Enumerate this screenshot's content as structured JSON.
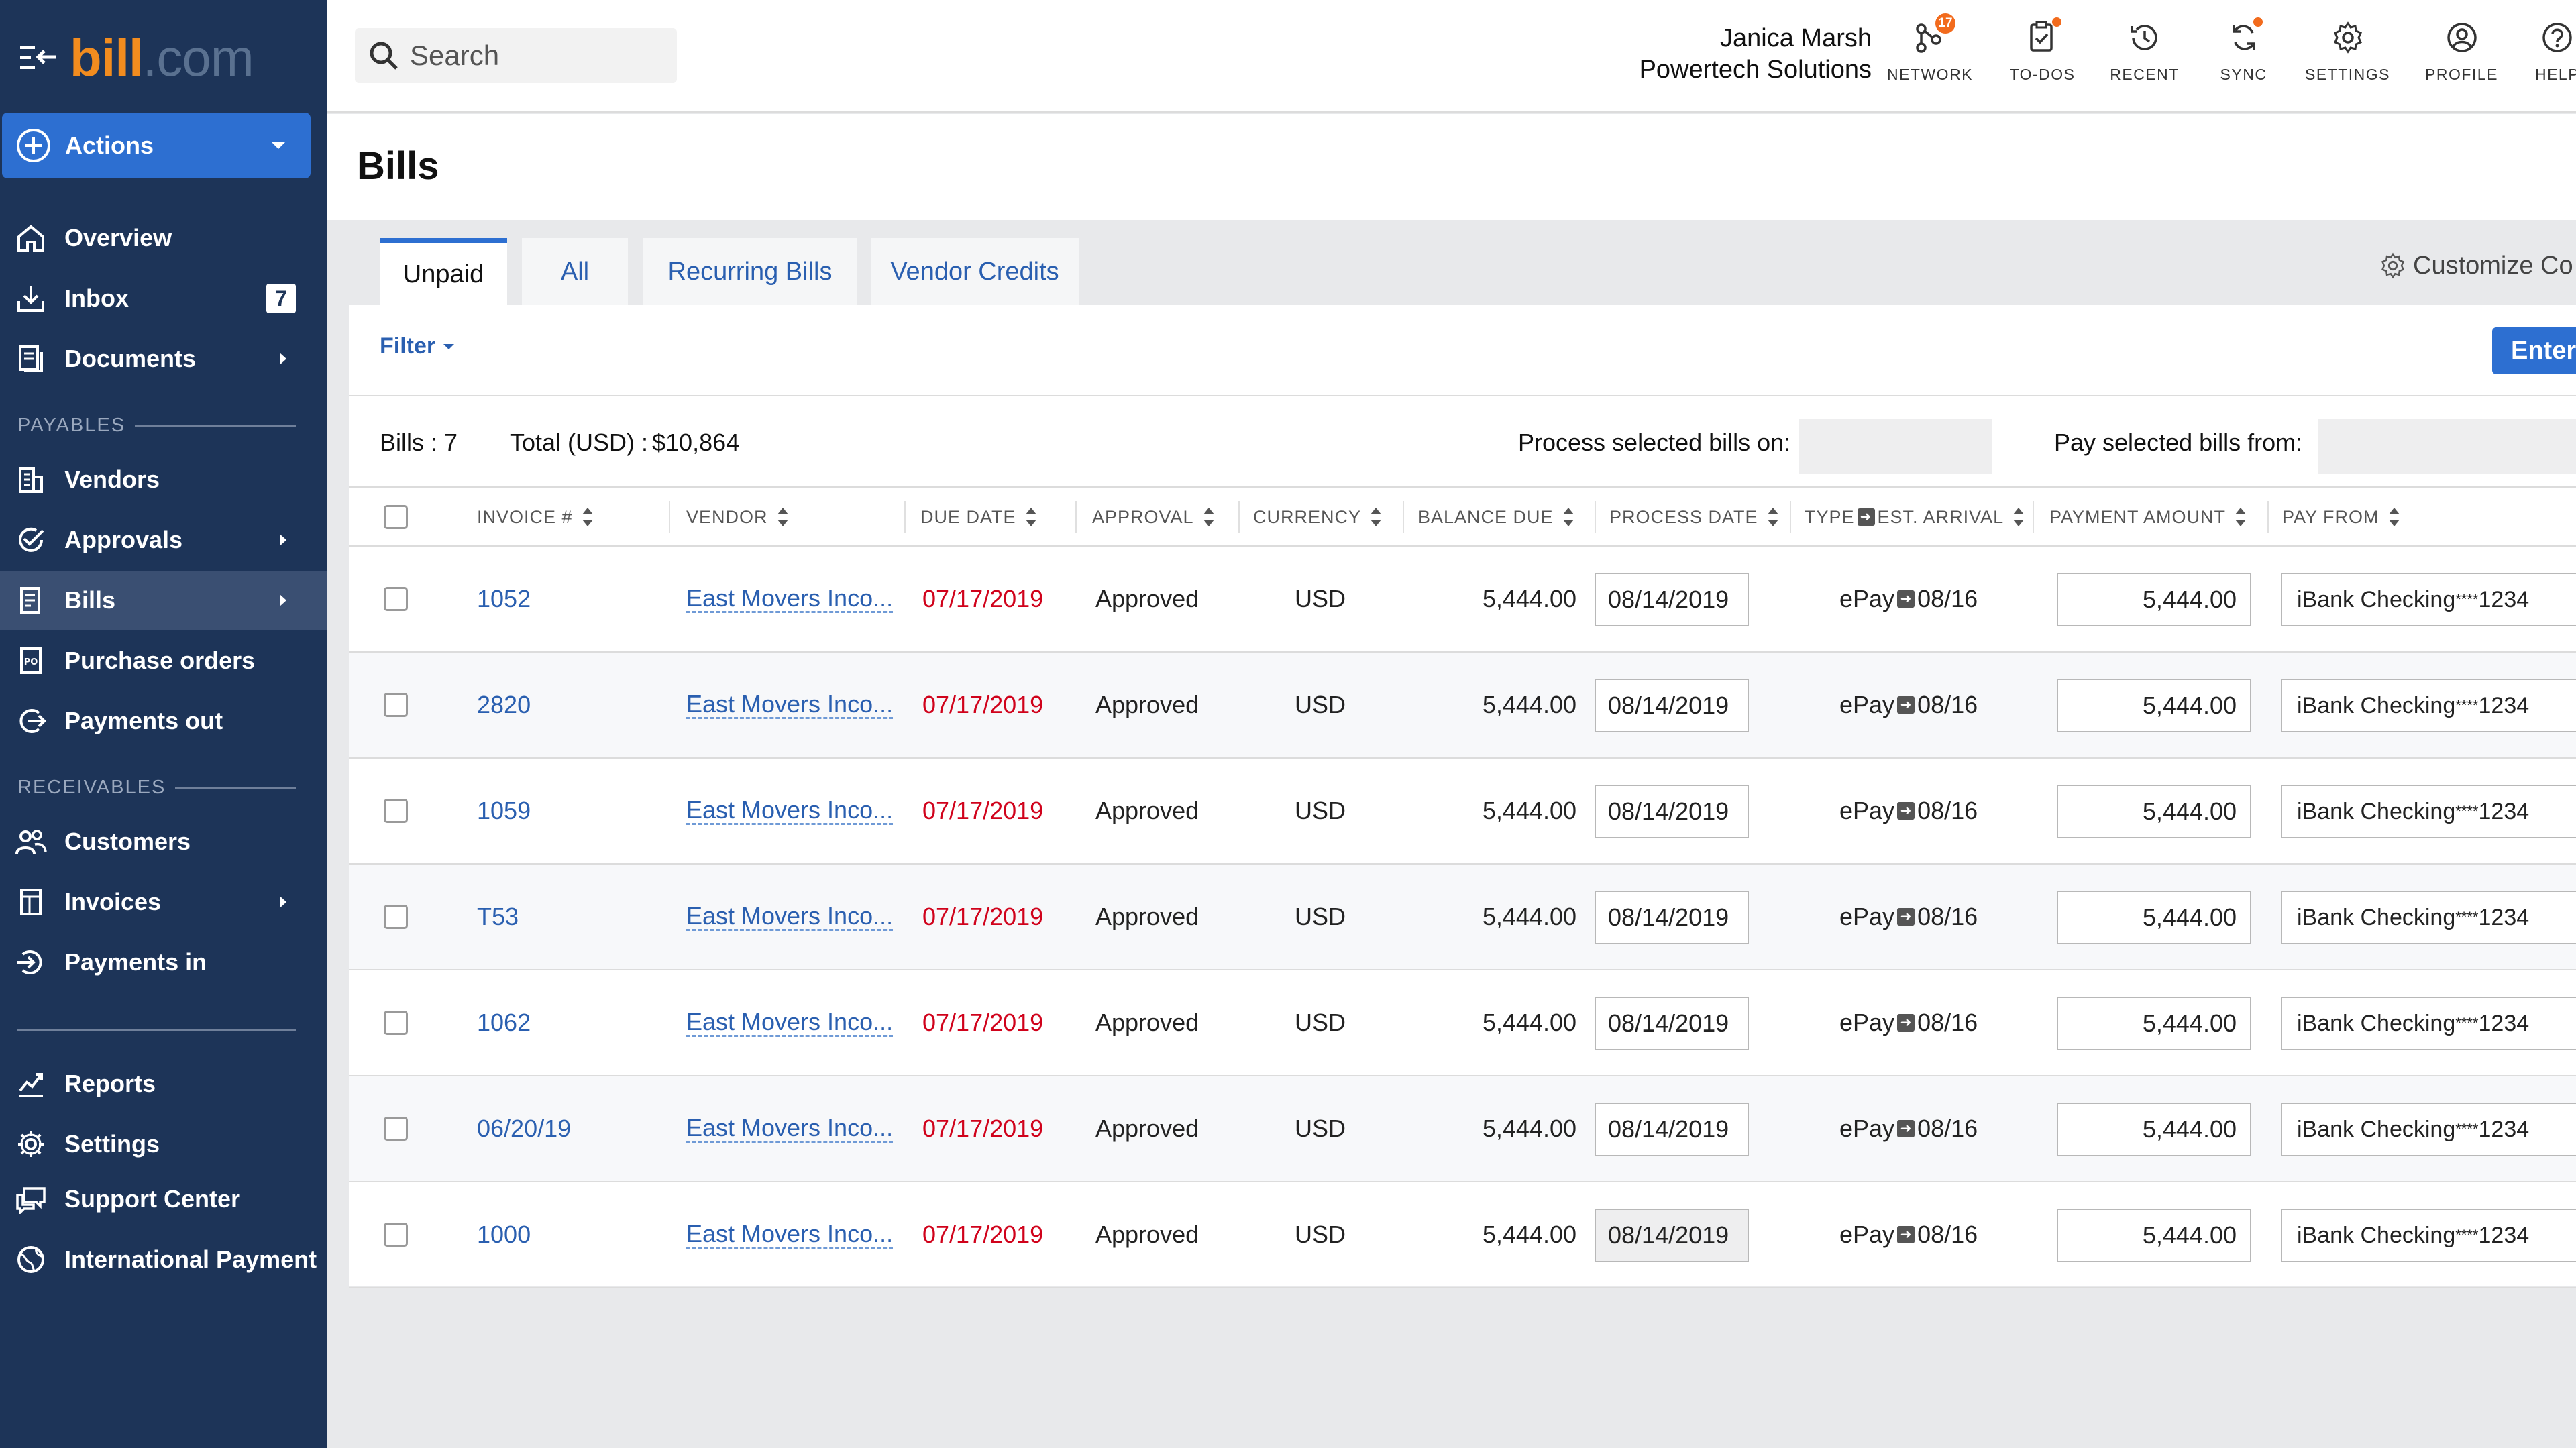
{
  "brand": {
    "bill": "bill",
    "com": ".com"
  },
  "actions_label": "Actions",
  "sidebar": {
    "items": [
      {
        "key": "overview",
        "label": "Overview"
      },
      {
        "key": "inbox",
        "label": "Inbox",
        "badge": "7"
      },
      {
        "key": "documents",
        "label": "Documents"
      },
      {
        "key": "vendors",
        "label": "Vendors"
      },
      {
        "key": "approvals",
        "label": "Approvals"
      },
      {
        "key": "bills",
        "label": "Bills"
      },
      {
        "key": "purchase-orders",
        "label": "Purchase orders"
      },
      {
        "key": "payments-out",
        "label": "Payments out"
      },
      {
        "key": "customers",
        "label": "Customers"
      },
      {
        "key": "invoices",
        "label": "Invoices"
      },
      {
        "key": "payments-in",
        "label": "Payments in"
      },
      {
        "key": "reports",
        "label": "Reports"
      },
      {
        "key": "settings",
        "label": "Settings"
      },
      {
        "key": "support-center",
        "label": "Support Center"
      },
      {
        "key": "international-payment",
        "label": "International Payment"
      }
    ],
    "sections": {
      "payables": "PAYABLES",
      "receivables": "RECEIVABLES"
    }
  },
  "header": {
    "search_placeholder": "Search",
    "user_name": "Janica Marsh",
    "company": "Powertech Solutions",
    "network_badge": "17",
    "icons": [
      {
        "key": "network",
        "label": "NETWORK",
        "icon": "network-icon"
      },
      {
        "key": "todos",
        "label": "TO-DOS",
        "icon": "clipboard-check-icon"
      },
      {
        "key": "recent",
        "label": "RECENT",
        "icon": "history-icon"
      },
      {
        "key": "sync",
        "label": "SYNC",
        "icon": "sync-icon"
      },
      {
        "key": "settings",
        "label": "SETTINGS",
        "icon": "gear-icon"
      },
      {
        "key": "profile",
        "label": "PROFILE",
        "icon": "user-icon"
      },
      {
        "key": "help",
        "label": "HELP",
        "icon": "help-icon"
      }
    ]
  },
  "page": {
    "title": "Bills"
  },
  "tabs": [
    "Unpaid",
    "All",
    "Recurring Bills",
    "Vendor Credits"
  ],
  "customize_label": "Customize Co",
  "filter_label": "Filter",
  "enter_label": "Enter",
  "summary": {
    "bills_label": "Bills :",
    "bills_count": "7",
    "total_label": "Total (USD) :",
    "total_value": "$10,864",
    "process_label": "Process selected bills on:",
    "pay_label": "Pay selected bills from:"
  },
  "table": {
    "columns": {
      "invoice": "INVOICE #",
      "vendor": "VENDOR",
      "due_date": "DUE DATE",
      "approval": "APPROVAL",
      "currency": "CURRENCY",
      "balance_due": "BALANCE DUE",
      "process_date": "PROCESS DATE",
      "type": "TYPE",
      "est_arrival": "EST. ARRIVAL",
      "payment_amount": "PAYMENT AMOUNT",
      "pay_from": "PAY FROM"
    },
    "rows": [
      {
        "invoice": "1052",
        "vendor": "East Movers Inco...",
        "due_date": "07/17/2019",
        "approval": "Approved",
        "currency": "USD",
        "balance_due": "5,444.00",
        "process_date": "08/14/2019",
        "type": "ePay",
        "est_arrival": "08/16",
        "payment_amount": "5,444.00",
        "pay_from_name": "iBank Checking ",
        "pay_from_mask": "****",
        "pay_from_last4": "1234"
      },
      {
        "invoice": "2820",
        "vendor": "East Movers Inco...",
        "due_date": "07/17/2019",
        "approval": "Approved",
        "currency": "USD",
        "balance_due": "5,444.00",
        "process_date": "08/14/2019",
        "type": "ePay",
        "est_arrival": "08/16",
        "payment_amount": "5,444.00",
        "pay_from_name": "iBank Checking ",
        "pay_from_mask": "****",
        "pay_from_last4": "1234"
      },
      {
        "invoice": "1059",
        "vendor": "East Movers Inco...",
        "due_date": "07/17/2019",
        "approval": "Approved",
        "currency": "USD",
        "balance_due": "5,444.00",
        "process_date": "08/14/2019",
        "type": "ePay",
        "est_arrival": "08/16",
        "payment_amount": "5,444.00",
        "pay_from_name": "iBank Checking ",
        "pay_from_mask": "****",
        "pay_from_last4": "1234"
      },
      {
        "invoice": "T53",
        "vendor": "East Movers Inco...",
        "due_date": "07/17/2019",
        "approval": "Approved",
        "currency": "USD",
        "balance_due": "5,444.00",
        "process_date": "08/14/2019",
        "type": "ePay",
        "est_arrival": "08/16",
        "payment_amount": "5,444.00",
        "pay_from_name": "iBank Checking ",
        "pay_from_mask": "****",
        "pay_from_last4": "1234"
      },
      {
        "invoice": "1062",
        "vendor": "East Movers Inco...",
        "due_date": "07/17/2019",
        "approval": "Approved",
        "currency": "USD",
        "balance_due": "5,444.00",
        "process_date": "08/14/2019",
        "type": "ePay",
        "est_arrival": "08/16",
        "payment_amount": "5,444.00",
        "pay_from_name": "iBank Checking ",
        "pay_from_mask": "****",
        "pay_from_last4": "1234"
      },
      {
        "invoice": "06/20/19",
        "vendor": "East Movers Inco...",
        "due_date": "07/17/2019",
        "approval": "Approved",
        "currency": "USD",
        "balance_due": "5,444.00",
        "process_date": "08/14/2019",
        "type": "ePay",
        "est_arrival": "08/16",
        "payment_amount": "5,444.00",
        "pay_from_name": "iBank Checking ",
        "pay_from_mask": "****",
        "pay_from_last4": "1234"
      },
      {
        "invoice": "1000",
        "vendor": "East Movers Inco...",
        "due_date": "07/17/2019",
        "approval": "Approved",
        "currency": "USD",
        "balance_due": "5,444.00",
        "process_date": "08/14/2019",
        "type": "ePay",
        "est_arrival": "08/16",
        "payment_amount": "5,444.00",
        "pay_from_name": "iBank Checking ",
        "pay_from_mask": "****",
        "pay_from_last4": "1234"
      }
    ]
  },
  "colors": {
    "sidebar": "#1d3458",
    "accent": "#2d6fd1",
    "brand_orange": "#f28c1f",
    "due_red": "#d0021b",
    "link": "#2a5fb0"
  }
}
